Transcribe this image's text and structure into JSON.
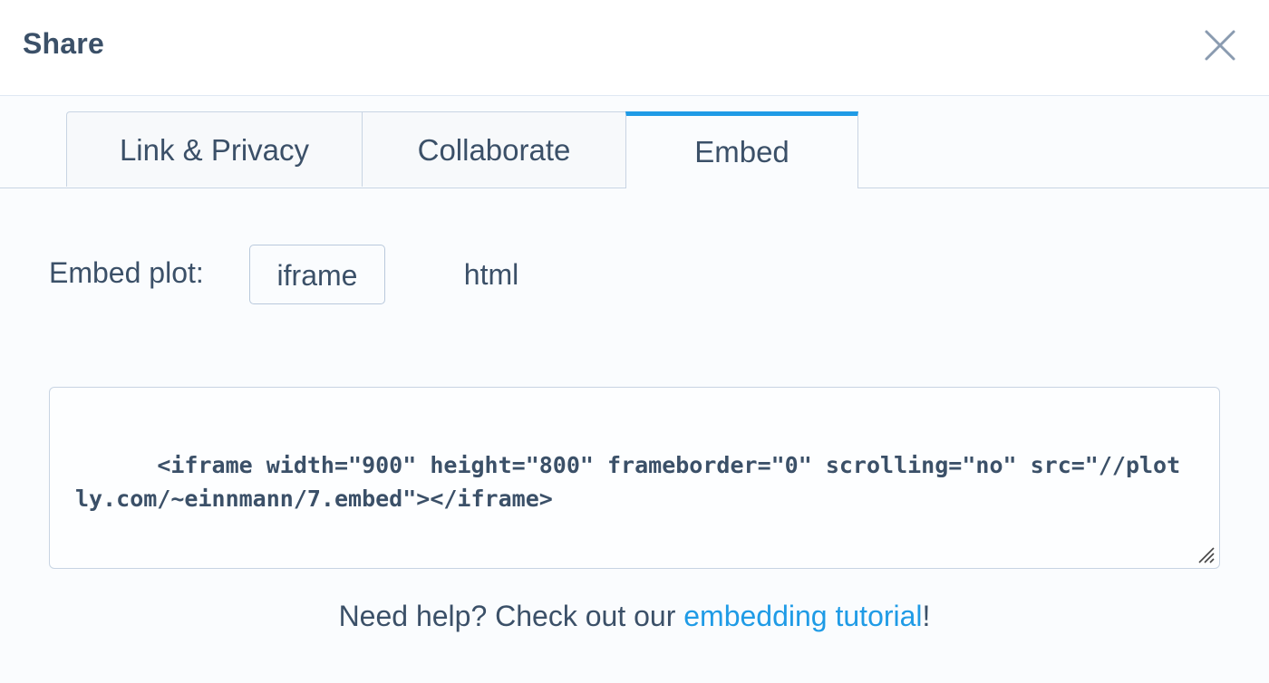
{
  "dialog": {
    "title": "Share"
  },
  "tabs": [
    {
      "label": "Link & Privacy",
      "active": false
    },
    {
      "label": "Collaborate",
      "active": false
    },
    {
      "label": "Embed",
      "active": true
    }
  ],
  "embed": {
    "label": "Embed plot:",
    "options": [
      {
        "label": "iframe",
        "selected": true
      },
      {
        "label": "html",
        "selected": false
      }
    ],
    "code": "<iframe width=\"900\" height=\"800\" frameborder=\"0\" scrolling=\"no\" src=\"//plotly.com/~einnmann/7.embed\"></iframe>"
  },
  "help": {
    "prefix": "Need help? Check out our ",
    "link_text": "embedding tutorial",
    "suffix": "!"
  },
  "icons": {
    "close": "close-icon",
    "resize": "resize-handle-icon"
  },
  "colors": {
    "accent": "#1f9be6",
    "text": "#3b5068",
    "border": "#c8d4e3"
  }
}
